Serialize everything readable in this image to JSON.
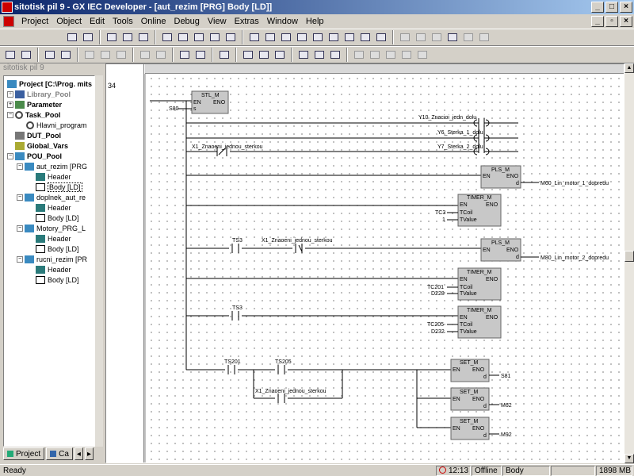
{
  "window": {
    "title": "sitotisk pil 9 - GX IEC Developer - [aut_rezim [PRG] Body [LD]]"
  },
  "menu": [
    "Project",
    "Object",
    "Edit",
    "Tools",
    "Online",
    "Debug",
    "View",
    "Extras",
    "Window",
    "Help"
  ],
  "project_panel": {
    "header": "sitotisk pil 9",
    "root": "Project [C:\\Prog. mits",
    "nodes": {
      "library_pool": "Library_Pool",
      "parameter": "Parameter",
      "task_pool": "Task_Pool",
      "hlavni_program": "Hlavni_program",
      "dut_pool": "DUT_Pool",
      "global_vars": "Global_Vars",
      "pou_pool": "POU_Pool",
      "aut_rezim": "aut_rezim [PRG",
      "doplnek": "doplnek_aut_re",
      "motory": "Motory_PRG_L",
      "rucni": "rucni_rezim [PR",
      "header": "Header",
      "body": "Body [LD]"
    },
    "tabs": {
      "project": "Project",
      "calls": "Ca"
    }
  },
  "editor": {
    "network_number": "34",
    "labels": {
      "s80": "S80",
      "stl_m": "STL_M",
      "en": "EN",
      "eno": "ENO",
      "s": "s",
      "d": "d",
      "y10": "Y10_Znacioi_jedn_dolu",
      "y6": "Y6_Sterka_1_dolu",
      "y7": "Y7_Sterka_2_dolu",
      "x1": "X1_Znaoeni_jednou_sterkou",
      "x1b": "X1_Znaoeni_jednou_sterkou",
      "x1c": "X1_Znaoeni_jednou_sterkou",
      "pls_m": "PLS_M",
      "m60": "M60_Lin_motor_1_dopredu",
      "timer_m": "TIMER_M",
      "tcoil": "TCoil",
      "tvalue": "TValue",
      "tc3": "TC3",
      "one": "1",
      "ts3": "TS3",
      "m80": "M80_Lin_motor_2_dopredu",
      "tc201": "TC201",
      "d228": "D228",
      "tc205": "TC205",
      "d232": "D232",
      "ts201": "TS201",
      "ts205": "TS205",
      "set_m": "SET_M",
      "s81": "S81",
      "m62": "M62",
      "m92": "M92"
    }
  },
  "status_bar": {
    "ready": "Ready",
    "time": "12:13",
    "mode": "Offline",
    "object": "Body",
    "memory": "1898 MB"
  }
}
